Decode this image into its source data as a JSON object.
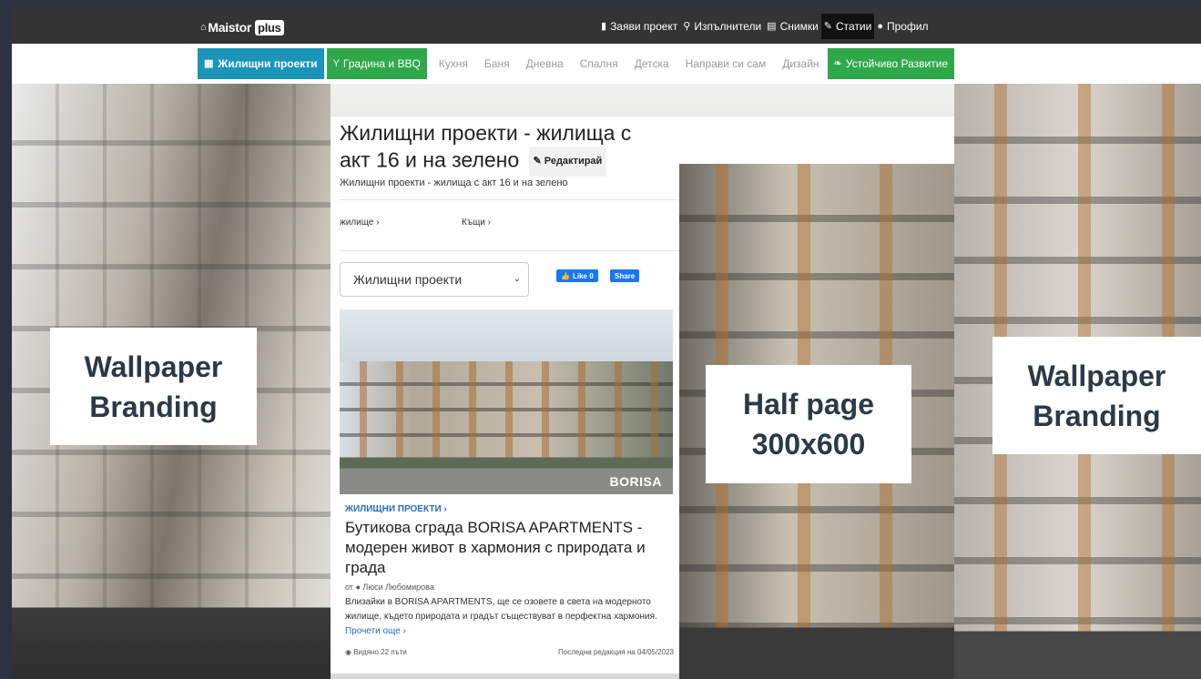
{
  "logo": {
    "text": "Maistor",
    "plus": "plus"
  },
  "topmenu": [
    {
      "label": "Заяви проект",
      "icon": "file-icon"
    },
    {
      "label": "Изпълнители",
      "icon": "search-icon"
    },
    {
      "label": "Снимки",
      "icon": "images-icon"
    },
    {
      "label": "Статии",
      "icon": "edit-icon"
    },
    {
      "label": "Профил",
      "icon": "user-icon"
    }
  ],
  "categories": {
    "housing": "Жилищни проекти",
    "garden": "Градина и BBQ",
    "items": [
      "Кухня",
      "Баня",
      "Дневна",
      "Спалня",
      "Детска",
      "Направи си сам",
      "Дизайн"
    ],
    "sustainable": "Устойчиво Развитие"
  },
  "page": {
    "title": "Жилищни проекти - жилища с акт 16 и на зелено",
    "edit_label": "Редактирай",
    "subtitle": "Жилищни проекти - жилища с акт 16 и на зелено",
    "tag1": "жилище",
    "tag2": "Къщи",
    "select_value": "Жилищни проекти",
    "fb_like": "Like 0",
    "fb_share": "Share"
  },
  "article": {
    "photo_brand": "BORISA",
    "category": "ЖИЛИЩНИ ПРОЕКТИ",
    "title": "Бутикова сграда BORISA APARTMENTS - модерен живот в хармония с природата и града",
    "author_prefix": "от",
    "author": "Люси Любомирова",
    "excerpt": "Влизайки в BORISA APARTMENTS, ще се озовете в света на модерното жилище, където природата и градът съществуват в перфектна хармония.",
    "read_more": "Прочети още",
    "views": "Видяно 22 пъти",
    "last_edit": "Последна редакция на 04/05/2023"
  },
  "banners": {
    "left": "Wallpaper Branding",
    "middle": "Half page 300x600",
    "right": "Wallpaper Branding"
  },
  "colors": {
    "nav_bg": "#343434",
    "housing_blue": "#1a95b8",
    "green": "#2fa84a",
    "link_blue": "#2a6ebb",
    "page_bg": "#2c3340"
  }
}
